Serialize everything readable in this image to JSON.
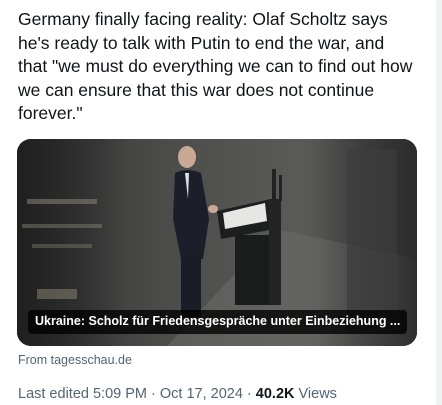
{
  "tweet": {
    "text": "Germany finally facing reality: Olaf Scholtz says\nhe's ready to talk with Putin to end the war, and\nthat \"we must do everything we can to find out how\nwe can ensure that this war does not continue\nforever.\""
  },
  "card": {
    "caption": "Ukraine: Scholz für Friedensgespräche unter Einbeziehung ...",
    "source": "From tagesschau.de"
  },
  "meta": {
    "edited": "Last edited 5:09 PM · Oct 17, 2024 · ",
    "views_count": "40.2K",
    "views_label": " Views"
  }
}
